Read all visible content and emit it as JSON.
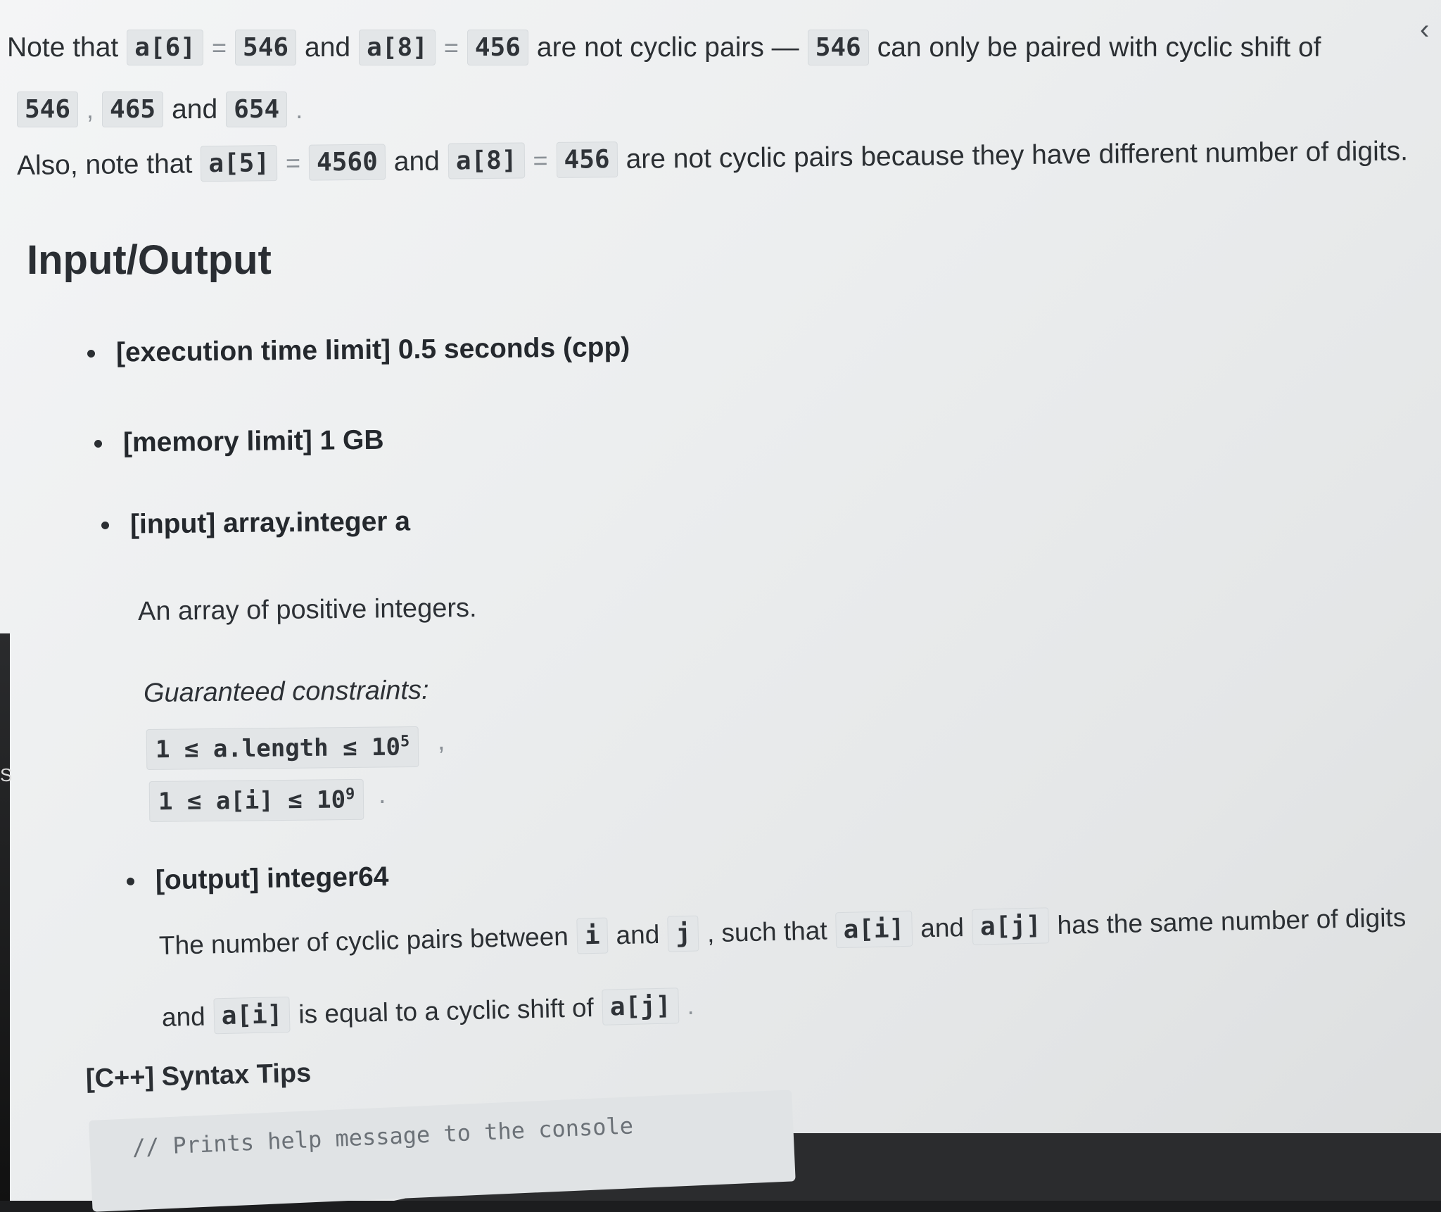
{
  "note1": {
    "t1": "Note that",
    "c1": "a[6]",
    "eq1": "=",
    "v1": "546",
    "t2": "and",
    "c2": "a[8]",
    "eq2": "=",
    "v2": "456",
    "t3": "are not cyclic pairs —",
    "c3": "546",
    "t4": "can only be paired with cyclic shift of"
  },
  "note1b": {
    "c1": "546",
    "sep": ",",
    "c2": "465",
    "t1": "and",
    "c3": "654",
    "end": "."
  },
  "note2": {
    "t1": "Also, note that",
    "c1": "a[5]",
    "eq1": "=",
    "v1": "4560",
    "t2": "and",
    "c2": "a[8]",
    "eq2": "=",
    "v2": "456",
    "t3": "are not cyclic pairs because they have different number of digits."
  },
  "heading": "Input/Output",
  "items": {
    "exec": "[execution time limit] 0.5 seconds (cpp)",
    "mem": "[memory limit] 1 GB",
    "input": "[input] array.integer a",
    "input_desc": "An array of positive integers.",
    "constraints_label": "Guaranteed constraints:",
    "con1_pre": "1 ≤ a.length ≤ 10",
    "con1_exp": "5",
    "con1_end": ",",
    "con2_pre": "1 ≤ a[i] ≤ 10",
    "con2_exp": "9",
    "con2_end": ".",
    "output": "[output] integer64"
  },
  "output_desc": {
    "t1": "The number of cyclic pairs between",
    "c1": "i",
    "t2": "and",
    "c2": "j",
    "t3": ", such that",
    "c3": "a[i]",
    "t4": "and",
    "c4": "a[j]",
    "t5": "has the same number of digits",
    "t6": "and",
    "c5": "a[i]",
    "t7": "is equal to a cyclic shift of",
    "c6": "a[j]",
    "end": "."
  },
  "syntax_title": "[C++] Syntax Tips",
  "code_line": "// Prints help message to the console",
  "icons": {
    "collapse": "chevron-left-icon"
  }
}
